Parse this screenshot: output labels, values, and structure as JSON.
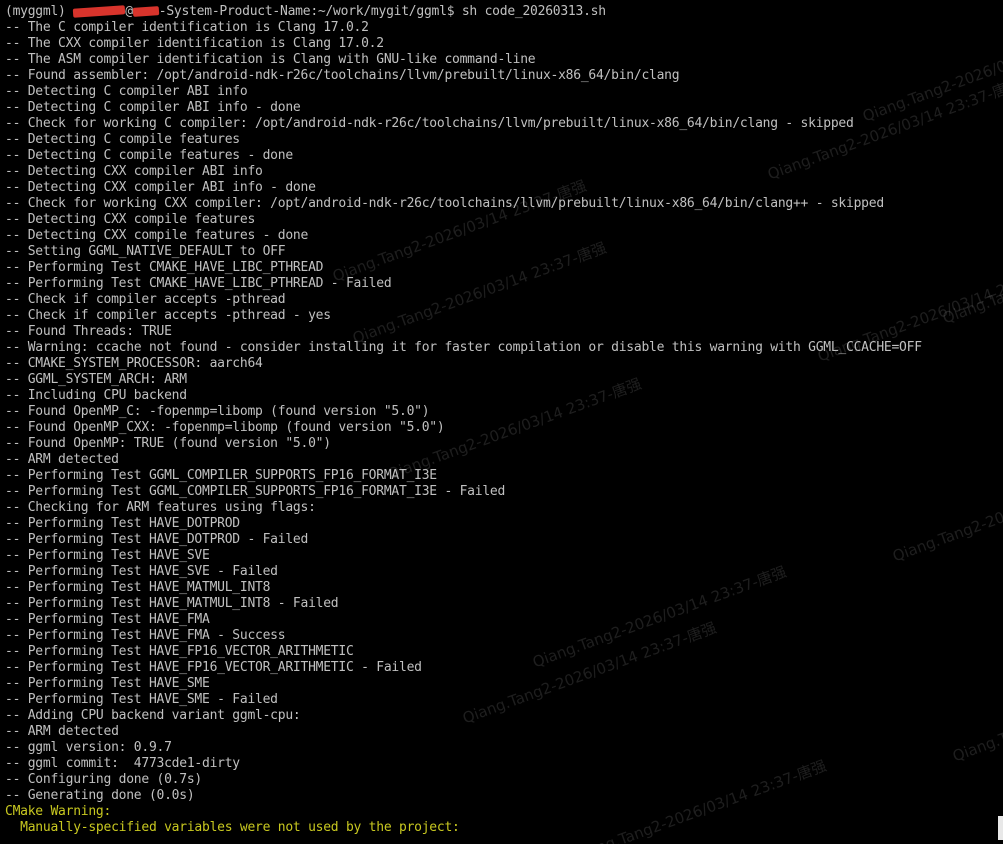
{
  "terminal": {
    "prompt": {
      "env": "(myggml)",
      "host_suffix": "-System-Product-Name:~/work/mygit/ggml$",
      "command": "sh code_20260313.sh"
    },
    "lines": [
      "-- The C compiler identification is Clang 17.0.2",
      "-- The CXX compiler identification is Clang 17.0.2",
      "-- The ASM compiler identification is Clang with GNU-like command-line",
      "-- Found assembler: /opt/android-ndk-r26c/toolchains/llvm/prebuilt/linux-x86_64/bin/clang",
      "-- Detecting C compiler ABI info",
      "-- Detecting C compiler ABI info - done",
      "-- Check for working C compiler: /opt/android-ndk-r26c/toolchains/llvm/prebuilt/linux-x86_64/bin/clang - skipped",
      "-- Detecting C compile features",
      "-- Detecting C compile features - done",
      "-- Detecting CXX compiler ABI info",
      "-- Detecting CXX compiler ABI info - done",
      "-- Check for working CXX compiler: /opt/android-ndk-r26c/toolchains/llvm/prebuilt/linux-x86_64/bin/clang++ - skipped",
      "-- Detecting CXX compile features",
      "-- Detecting CXX compile features - done",
      "-- Setting GGML_NATIVE_DEFAULT to OFF",
      "-- Performing Test CMAKE_HAVE_LIBC_PTHREAD",
      "-- Performing Test CMAKE_HAVE_LIBC_PTHREAD - Failed",
      "-- Check if compiler accepts -pthread",
      "-- Check if compiler accepts -pthread - yes",
      "-- Found Threads: TRUE",
      "-- Warning: ccache not found - consider installing it for faster compilation or disable this warning with GGML_CCACHE=OFF",
      "-- CMAKE_SYSTEM_PROCESSOR: aarch64",
      "-- GGML_SYSTEM_ARCH: ARM",
      "-- Including CPU backend",
      "-- Found OpenMP_C: -fopenmp=libomp (found version \"5.0\")",
      "-- Found OpenMP_CXX: -fopenmp=libomp (found version \"5.0\")",
      "-- Found OpenMP: TRUE (found version \"5.0\")",
      "-- ARM detected",
      "-- Performing Test GGML_COMPILER_SUPPORTS_FP16_FORMAT_I3E",
      "-- Performing Test GGML_COMPILER_SUPPORTS_FP16_FORMAT_I3E - Failed",
      "-- Checking for ARM features using flags:",
      "-- Performing Test HAVE_DOTPROD",
      "-- Performing Test HAVE_DOTPROD - Failed",
      "-- Performing Test HAVE_SVE",
      "-- Performing Test HAVE_SVE - Failed",
      "-- Performing Test HAVE_MATMUL_INT8",
      "-- Performing Test HAVE_MATMUL_INT8 - Failed",
      "-- Performing Test HAVE_FMA",
      "-- Performing Test HAVE_FMA - Success",
      "-- Performing Test HAVE_FP16_VECTOR_ARITHMETIC",
      "-- Performing Test HAVE_FP16_VECTOR_ARITHMETIC - Failed",
      "-- Performing Test HAVE_SME",
      "-- Performing Test HAVE_SME - Failed",
      "-- Adding CPU backend variant ggml-cpu:",
      "-- ARM detected",
      "-- ggml version: 0.9.7",
      "-- ggml commit:  4773cde1-dirty",
      "-- Configuring done (0.7s)",
      "-- Generating done (0.0s)"
    ],
    "warning_lines": [
      "CMake Warning:",
      "  Manually-specified variables were not used by the project:"
    ],
    "watermark": "Qiang.Tang2-2026/03/14 23:37-唐强",
    "colors": {
      "background": "#000000",
      "text": "#c0c0c0",
      "warning": "#c8c820",
      "redaction": "#d8342c"
    }
  }
}
